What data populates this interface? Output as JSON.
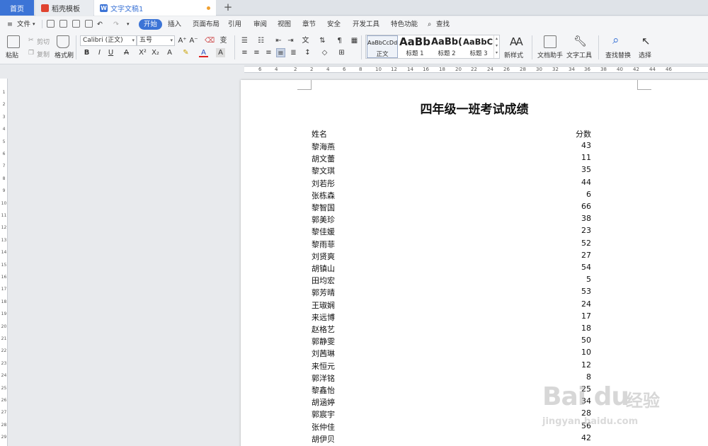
{
  "tabs": {
    "home": "首页",
    "docer": "稻壳模板",
    "doc": "文字文稿1"
  },
  "menu": {
    "file": "文件",
    "items": [
      "开始",
      "插入",
      "页面布局",
      "引用",
      "审阅",
      "视图",
      "章节",
      "安全",
      "开发工具",
      "特色功能"
    ],
    "search": "查找"
  },
  "ribbon": {
    "paste": "粘贴",
    "cut": "剪切",
    "copy": "复制",
    "format_painter": "格式刷",
    "font_name": "Calibri (正文)",
    "font_size": "五号",
    "bold": "B",
    "italic": "I",
    "underline": "U",
    "styles": [
      {
        "sample": "AaBbCcDd",
        "label": "正文"
      },
      {
        "sample": "AaBb",
        "label": "标题 1"
      },
      {
        "sample": "AaBb(",
        "label": "标题 2"
      },
      {
        "sample": "AaBbC(",
        "label": "标题 3"
      }
    ],
    "new_style": "新样式",
    "doc_helper": "文档助手",
    "text_tools": "文字工具",
    "find_replace": "查找替换",
    "select": "选择"
  },
  "ruler": {
    "top": [
      "6",
      "4",
      "2",
      "2",
      "4",
      "6",
      "8",
      "10",
      "12",
      "14",
      "16",
      "18",
      "20",
      "22",
      "24",
      "26",
      "28",
      "30",
      "32",
      "34",
      "36",
      "38",
      "40",
      "42",
      "44",
      "46"
    ],
    "left": [
      "1",
      "2",
      "3",
      "4",
      "5",
      "6",
      "7",
      "8",
      "9",
      "10",
      "11",
      "12",
      "13",
      "14",
      "15",
      "16",
      "17",
      "18",
      "19",
      "20",
      "21",
      "22",
      "23",
      "24",
      "25",
      "26",
      "27",
      "28",
      "29"
    ]
  },
  "document": {
    "title": "四年级一班考试成绩",
    "header_name": "姓名",
    "header_score": "分数",
    "rows": [
      {
        "name": "黎海燕",
        "score": "43"
      },
      {
        "name": "胡文蕾",
        "score": "11"
      },
      {
        "name": "黎文琪",
        "score": "35"
      },
      {
        "name": "刘若彤",
        "score": "44"
      },
      {
        "name": "张栋森",
        "score": "6"
      },
      {
        "name": "黎智国",
        "score": "66"
      },
      {
        "name": "郭美珍",
        "score": "38"
      },
      {
        "name": "黎佳媛",
        "score": "23"
      },
      {
        "name": "黎雨菲",
        "score": "52"
      },
      {
        "name": "刘贤爽",
        "score": "27"
      },
      {
        "name": "胡镇山",
        "score": "54"
      },
      {
        "name": "田均宏",
        "score": "5"
      },
      {
        "name": "郭芳晴",
        "score": "53"
      },
      {
        "name": "王琡娴",
        "score": "24"
      },
      {
        "name": "来远博",
        "score": "17"
      },
      {
        "name": "赵格艺",
        "score": "18"
      },
      {
        "name": "郭静雯",
        "score": "50"
      },
      {
        "name": "刘茜琳",
        "score": "10"
      },
      {
        "name": "来恒元",
        "score": "12"
      },
      {
        "name": "郭洋铭",
        "score": "8"
      },
      {
        "name": "黎鑫怡",
        "score": "25"
      },
      {
        "name": "胡涵婷",
        "score": "34"
      },
      {
        "name": "郭宸宇",
        "score": "28"
      },
      {
        "name": "张仲佳",
        "score": "56"
      },
      {
        "name": "胡伊贝",
        "score": "42"
      }
    ]
  },
  "watermark": {
    "brand": "Bai du",
    "brand_cn": "经验",
    "url": "jingyan.baidu.com"
  },
  "colors": {
    "accent": "#3c74d6",
    "modified_dot": "#f0a030"
  }
}
